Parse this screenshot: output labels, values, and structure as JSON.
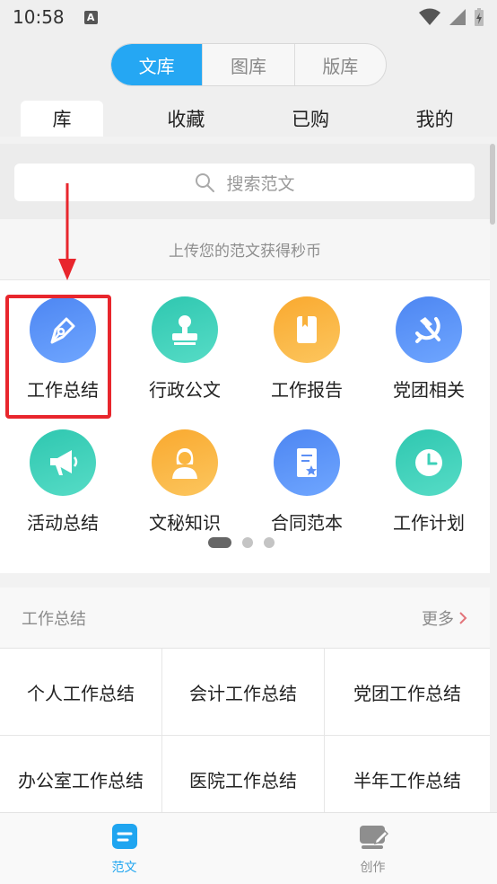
{
  "status_bar": {
    "time": "10:58",
    "badge": "A"
  },
  "segment_tabs": [
    {
      "label": "文库",
      "active": true
    },
    {
      "label": "图库",
      "active": false
    },
    {
      "label": "版库",
      "active": false
    }
  ],
  "sub_tabs": [
    {
      "label": "库",
      "active": true
    },
    {
      "label": "收藏",
      "active": false
    },
    {
      "label": "已购",
      "active": false
    },
    {
      "label": "我的",
      "active": false
    }
  ],
  "search": {
    "placeholder": "搜索范文"
  },
  "upload_hint": "上传您的范文获得秒币",
  "categories": [
    {
      "label": "工作总结",
      "icon": "pen-nib-icon",
      "color": "#5b8ff5"
    },
    {
      "label": "行政公文",
      "icon": "stamp-icon",
      "color": "#3dd0b8"
    },
    {
      "label": "工作报告",
      "icon": "book-icon",
      "color": "#fbb640"
    },
    {
      "label": "党团相关",
      "icon": "hammer-sickle-icon",
      "color": "#5b8ff5"
    },
    {
      "label": "活动总结",
      "icon": "megaphone-icon",
      "color": "#3dd0b8"
    },
    {
      "label": "文秘知识",
      "icon": "secretary-icon",
      "color": "#fbb640"
    },
    {
      "label": "合同范本",
      "icon": "contract-icon",
      "color": "#5b8ff5"
    },
    {
      "label": "工作计划",
      "icon": "clock-icon",
      "color": "#3dd0b8"
    }
  ],
  "pager": {
    "pages": 3,
    "current": 1
  },
  "section": {
    "title": "工作总结",
    "more": "更多"
  },
  "summary_items": [
    "个人工作总结",
    "会计工作总结",
    "党团工作总结",
    "办公室工作总结",
    "医院工作总结",
    "半年工作总结"
  ],
  "bottom_nav": [
    {
      "label": "范文",
      "icon": "document-icon",
      "active": true,
      "color": "#1fa5f0"
    },
    {
      "label": "创作",
      "icon": "edit-icon",
      "active": false,
      "color": "#8e8e8e"
    }
  ],
  "colors": {
    "accent": "#25a7f3",
    "highlight": "#e8262d"
  }
}
